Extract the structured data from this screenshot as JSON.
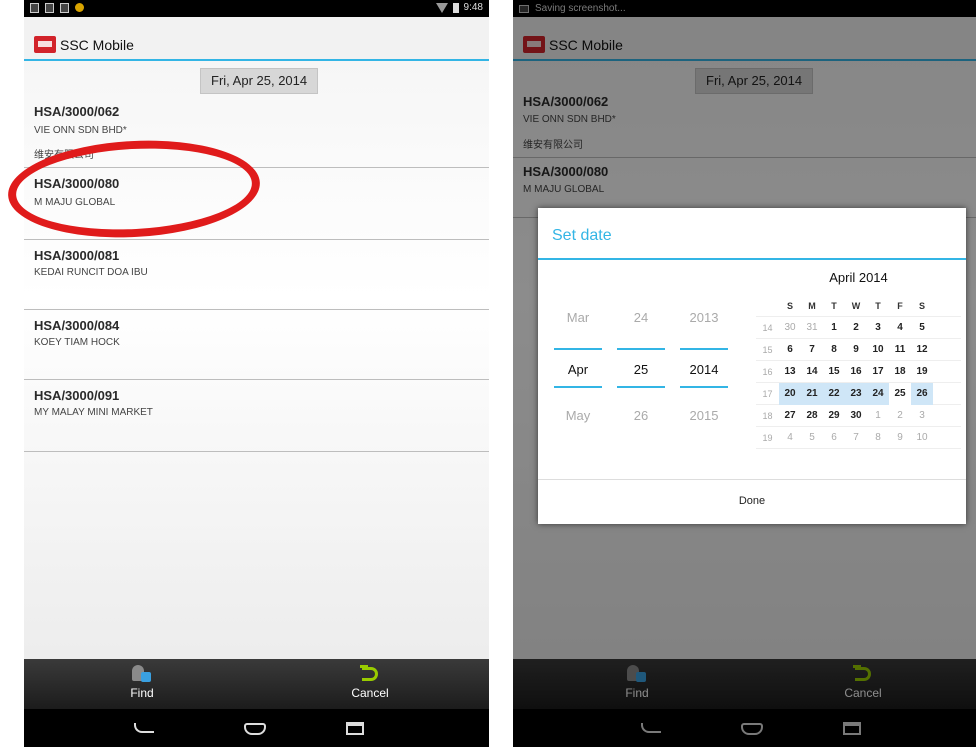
{
  "left": {
    "app_title": "SSC Mobile",
    "status_time": "9:48",
    "date_button": "Fri, Apr 25, 2014",
    "items": [
      {
        "code": "HSA/3000/062",
        "name": "VIE ONN SDN BHD*",
        "chinese": "维安有限公司"
      },
      {
        "code": "HSA/3000/080",
        "name": "M MAJU GLOBAL"
      },
      {
        "code": "HSA/3000/081",
        "name": "KEDAI RUNCIT DOA IBU"
      },
      {
        "code": "HSA/3000/084",
        "name": "KOEY TIAM HOCK"
      },
      {
        "code": "HSA/3000/091",
        "name": "MY MALAY MINI MARKET"
      }
    ],
    "find_label": "Find",
    "cancel_label": "Cancel"
  },
  "right": {
    "status_text": "Saving screenshot...",
    "app_title": "SSC Mobile",
    "date_button": "Fri, Apr 25, 2014",
    "items": [
      {
        "code": "HSA/3000/062",
        "name": "VIE ONN SDN BHD*",
        "chinese": "维安有限公司"
      },
      {
        "code": "HSA/3000/080",
        "name": "M MAJU GLOBAL"
      }
    ],
    "find_label": "Find",
    "cancel_label": "Cancel",
    "dialog": {
      "title": "Set date",
      "spinners": {
        "month": {
          "prev": "Mar",
          "cur": "Apr",
          "next": "May"
        },
        "day": {
          "prev": "24",
          "cur": "25",
          "next": "26"
        },
        "year": {
          "prev": "2013",
          "cur": "2014",
          "next": "2015"
        }
      },
      "calendar": {
        "month_label": "April 2014",
        "weekdays": [
          "S",
          "M",
          "T",
          "W",
          "T",
          "F",
          "S"
        ],
        "weeks": [
          "14",
          "15",
          "16",
          "17",
          "18",
          "19"
        ],
        "rows": [
          [
            "30",
            "31",
            "1",
            "2",
            "3",
            "4",
            "5"
          ],
          [
            "6",
            "7",
            "8",
            "9",
            "10",
            "11",
            "12"
          ],
          [
            "13",
            "14",
            "15",
            "16",
            "17",
            "18",
            "19"
          ],
          [
            "20",
            "21",
            "22",
            "23",
            "24",
            "25",
            "26"
          ],
          [
            "27",
            "28",
            "29",
            "30",
            "1",
            "2",
            "3"
          ],
          [
            "4",
            "5",
            "6",
            "7",
            "8",
            "9",
            "10"
          ]
        ],
        "selected_date": "25"
      },
      "done_label": "Done"
    }
  },
  "colors": {
    "accent": "#33b5e5",
    "annotation": "#e01b1b",
    "cancel_icon": "#99cc00",
    "find_badge": "#3aa0e0"
  }
}
